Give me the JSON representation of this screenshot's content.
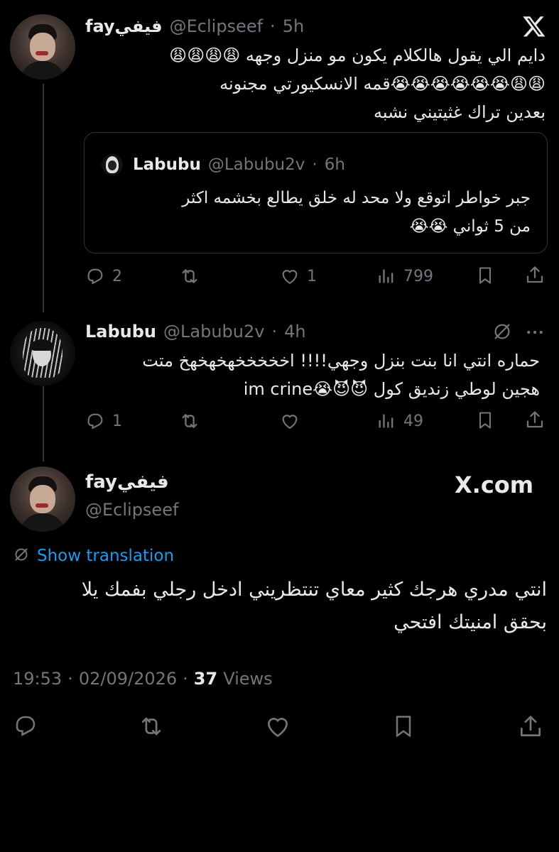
{
  "tweet1": {
    "display_name": "fayفيفي",
    "handle": "@Eclipseef",
    "time": "5h",
    "lines": [
      "دايم الي يقول هالكلام يكون مو منزل وجهه 😩😩😩😩",
      "😩😩😭😭😭😭😭😭قمه الانسكيورتي مجنونه",
      "بعدين تراك غثيتيني نشبه"
    ],
    "quote": {
      "display_name": "Labubu",
      "handle": "@Labubu2v",
      "time": "6h",
      "lines": [
        "جبر خواطر اتوقع ولا محد له خلق يطالع بخشمه اكثر",
        "من 5 ثواني 😭😭"
      ]
    },
    "actions": {
      "replies": "2",
      "likes": "1",
      "views": "799"
    }
  },
  "tweet2": {
    "display_name": "Labubu",
    "handle": "@Labubu2v",
    "time": "4h",
    "lines": [
      "حماره انتي انا بنت بنزل وجهي!!!! اخخخخخهخهخهخ متت",
      "هجين لوطي زنديق كول 😈😈😭im crine"
    ],
    "actions": {
      "replies": "1",
      "views": "49"
    }
  },
  "main_tweet": {
    "display_name": "fayفيفي",
    "handle": "@Eclipseef",
    "watermark": "X.com",
    "show_translation": "Show translation",
    "lines": [
      "انتي مدري هرجك كثير معاي تنتظريني ادخل رجلي بفمك يلا",
      "بحقق امنيتك افتحي"
    ],
    "meta": {
      "time": "19:53",
      "date": "02/09/2026",
      "views_count": "37",
      "views_label": "Views"
    }
  },
  "icons": {
    "x_logo": "x-logo-icon",
    "reply": "reply-icon",
    "retweet": "retweet-icon",
    "like": "heart-icon",
    "views": "views-chart-icon",
    "bookmark": "bookmark-icon",
    "share": "share-icon",
    "translate": "translate-icon",
    "more": "more-icon"
  }
}
